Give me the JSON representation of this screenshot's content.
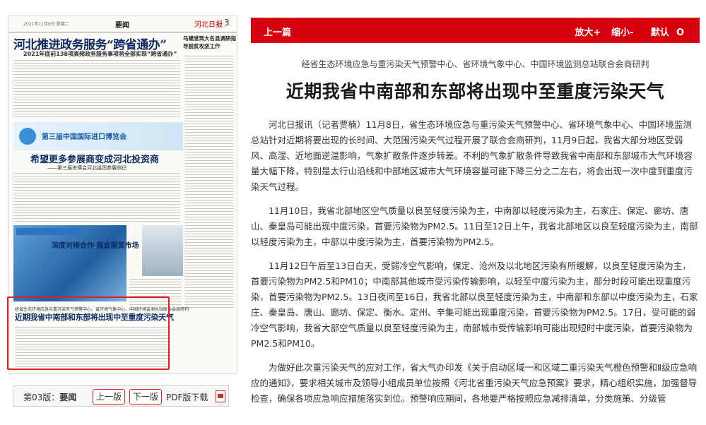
{
  "thumbnail": {
    "header": {
      "date": "2021年11月9日 星期二",
      "section": "要闻",
      "brand": "河北日报",
      "page_number": "3"
    },
    "headline1": "河北推进政务服务“跨省通办”",
    "headline1_sub": "2021年底前138项高频政务服务事项将全部实现“跨省通办”",
    "side_headline": "马建堂到大名县调研指导脱贫攻坚工作",
    "expo_banner": "第三届中国国际进口博览会",
    "headline2": "希望更多参展商变成河北投资商",
    "headline2_sub": "——第三届进博会河北组团参展侧记",
    "headline3": "深度对接合作 掘金服贸市场",
    "selected_kicker": "经省生态环境应急与重污染天气预警中心、省环境气象中心、中国环境监测总站联合会商研判",
    "selected_title": "近期我省中南部和东部将出现中至重度污染天气"
  },
  "pager": {
    "label_prefix": "第03版：",
    "label_section": "要闻",
    "prev": "上一版",
    "next": "下一版",
    "pdf": "PDF版下载"
  },
  "toolbar": {
    "prev": "上一篇",
    "zoom_in": "放大+",
    "zoom_out": "缩小-",
    "default": "默认",
    "default_icon": "O"
  },
  "article": {
    "kicker": "经省生态环境应急与重污染天气预警中心、省环境气象中心、中国环境监测总站联合会商研判",
    "title": "近期我省中南部和东部将出现中至重度污染天气",
    "paragraphs": [
      "河北日报讯（记者贾楠）11月8日，省生态环境应急与重污染天气预警中心、省环境气象中心、中国环境监测总站针对近期将要出现的长时间、大范围污染天气过程开展了联合会商研判，11月9日起，我省大部分地区受弱风、高湿、近地面逆温影响，气象扩散条件逐步转差。不利的气象扩散条件导致我省中南部和东部城市大气环境容量大幅下降，特别是太行山沿线和中部地区城市大气环境容量可能下降三分之二左右，将会出现一次中度到重度污染天气过程。",
      "11月10日，我省北部地区空气质量以良至轻度污染为主，中南部以轻度污染为主，石家庄、保定、廊坊、唐山、秦皇岛可能出现中度污染，首要污染物为PM2.5。11日至12日上午，我省北部地区以良至轻度污染为主，南部以轻度污染为主，中部以中度污染为主，首要污染物为PM2.5。",
      "11月12日午后至13日白天，受弱冷空气影响，保定、沧州及以北地区污染有所缓解，以良至轻度污染为主，首要污染物为PM2.5和PM10；中南部其他城市受污染传输影响，以轻至中度污染为主，部分时段可能出现重度污染，首要污染物为PM2.5。13日夜间至16日，我省北部以良至轻度污染为主，中南部和东部以中度污染为主，石家庄、秦皇岛、唐山、廊坊、保定、衡水、定州、辛集可能出现重度污染，首要污染物为PM2.5。17日，受可能的弱冷空气影响，我省大部空气质量以良至轻度污染为主，南部城市受传输影响可能出现短时中度污染，首要污染物为PM2.5和PM10。",
      "为做好此次重污染天气的应对工作，省大气办印发《关于启动区域一和区域二重污染天气橙色预警和Ⅱ级应急响应的通知》，要求相关城市及领导小组成员单位按照《河北省重污染天气应急预案》要求，精心组织实施，加强督导检查，确保各项应急响应措施落实到位。预警响应期间，各地要严格按照应急减排清单，分类施策、分级管"
    ]
  },
  "colors": {
    "accent_red": "#d7000f",
    "selection_red": "#e51c23",
    "headline_navy": "#0e2b63"
  }
}
